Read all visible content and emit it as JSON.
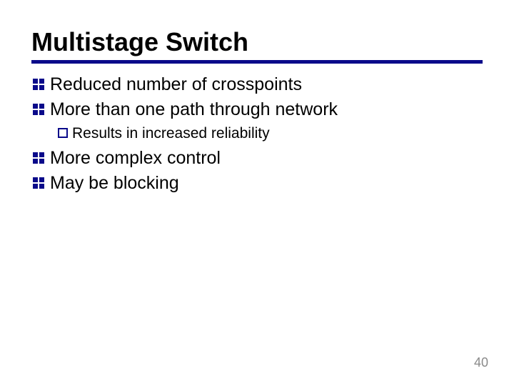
{
  "title": "Multistage Switch",
  "bullets": {
    "b1": "Reduced number of crosspoints",
    "b2": "More than one path through network",
    "b2a": "Results in increased reliability",
    "b3": "More complex control",
    "b4": "May be blocking"
  },
  "page_number": "40",
  "colors": {
    "rule": "#0a0a8a",
    "bullet_fill": "#0a0a8a",
    "sub_bullet_stroke": "#0a0a8a"
  }
}
